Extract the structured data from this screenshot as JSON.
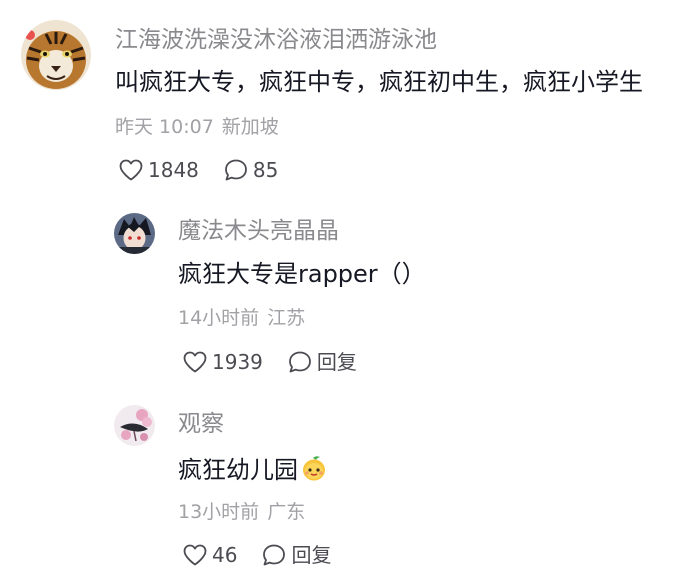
{
  "comments": [
    {
      "author": "江海波洗澡没沐浴液泪洒游泳池",
      "avatar_icon": "tiger-avatar-icon",
      "text": "叫疯狂大专，疯狂中专，疯狂初中生，疯狂小学生",
      "time": "昨天 10:07",
      "location": "新加坡",
      "likes": "1848",
      "replies_count": "85"
    },
    {
      "author": "魔法木头亮晶晶",
      "avatar_icon": "anime-character-avatar-icon",
      "text": "疯狂大专是rapper（）",
      "time": "14小时前",
      "location": "江苏",
      "likes": "1939",
      "reply_label": "回复"
    },
    {
      "author": "观察",
      "avatar_icon": "flower-avatar-icon",
      "text": "疯狂幼儿园",
      "text_emoji": "mango-face-emoji-icon",
      "time": "13小时前",
      "location": "广东",
      "likes": "46",
      "reply_label": "回复"
    }
  ],
  "colors": {
    "text": "#161823",
    "author": "#8a8a8e",
    "meta": "#a1a1a6",
    "action": "#4b4b52"
  }
}
